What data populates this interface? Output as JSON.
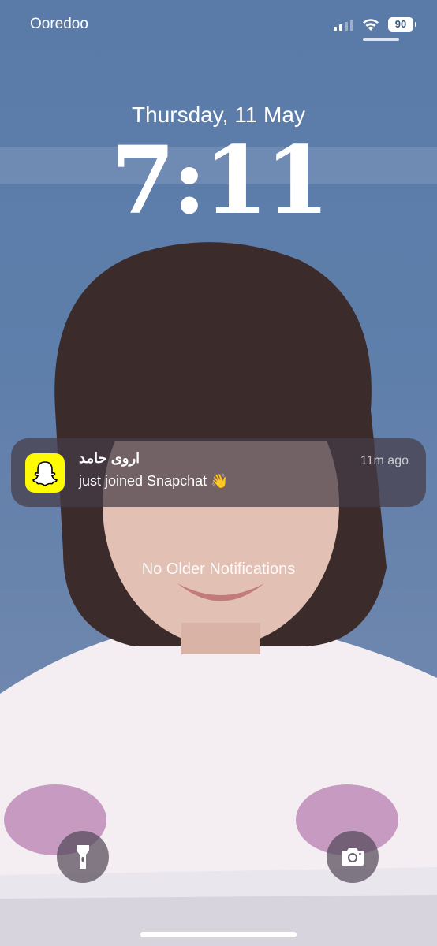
{
  "status_bar": {
    "carrier": "Ooredoo",
    "battery": "90",
    "icons": [
      "cellular-signal-icon",
      "wifi-icon",
      "battery-icon"
    ]
  },
  "lock_screen": {
    "date": "Thursday, 11 May",
    "time": "7:11"
  },
  "notification": {
    "app_icon": "snapchat-ghost-icon",
    "title": "اروى حامد",
    "body": "just joined Snapchat 👋",
    "time": "11m ago"
  },
  "footer_text": "No Older Notifications",
  "quick_actions": {
    "left": "flashlight-icon",
    "right": "camera-icon"
  },
  "colors": {
    "wallpaper_blue": "#5b7aa6",
    "snapchat_yellow": "#fffc00"
  }
}
